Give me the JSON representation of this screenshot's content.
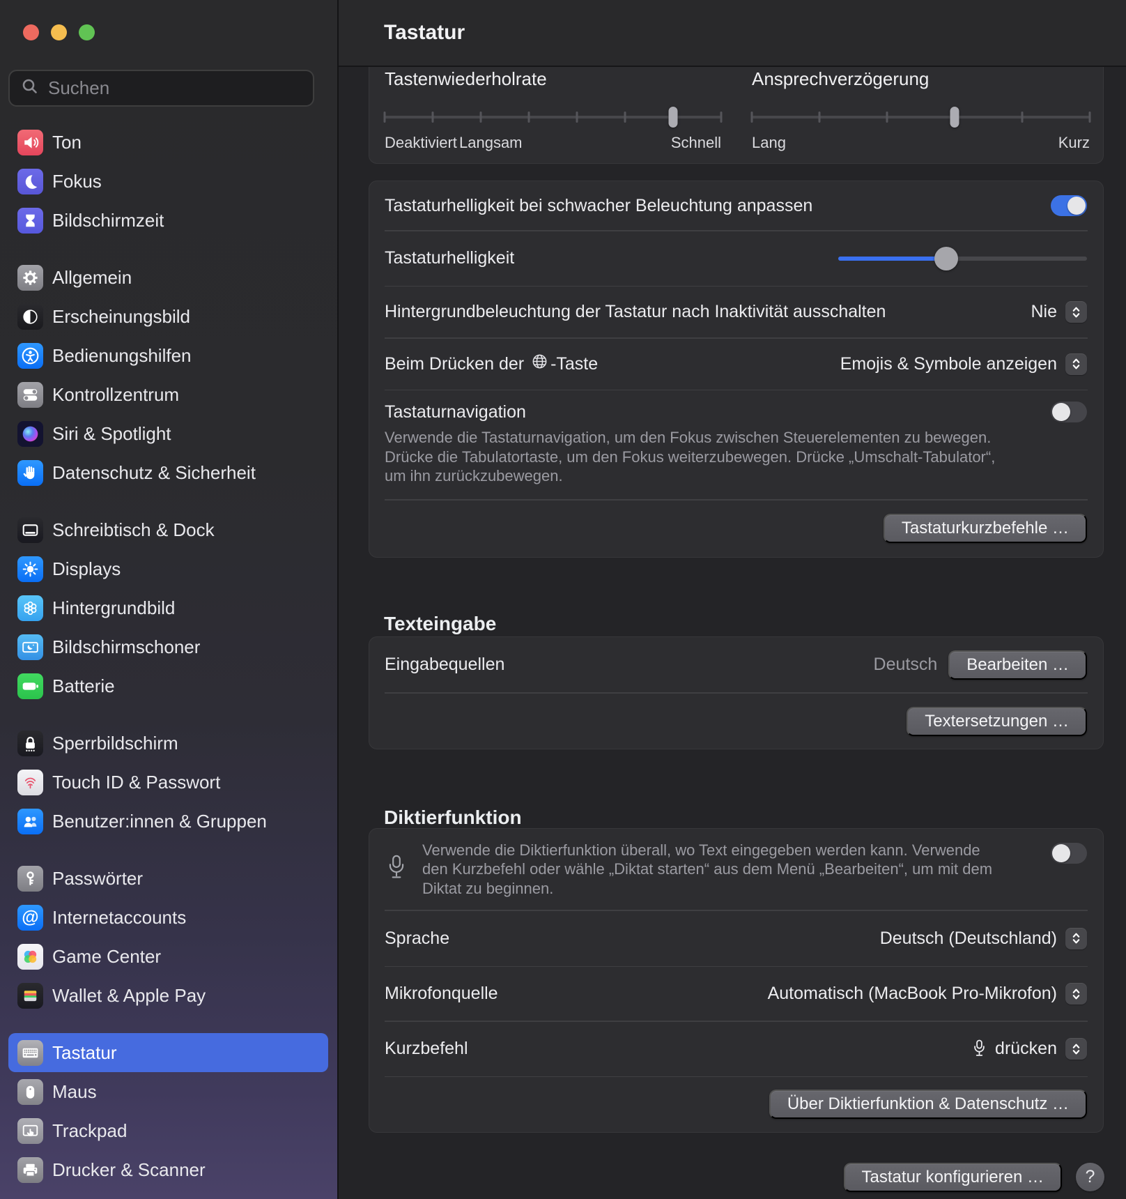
{
  "window": {
    "title": "Tastatur"
  },
  "sidebar": {
    "search_placeholder": "Suchen",
    "items": [
      {
        "label": "Ton",
        "icon": "speaker-icon"
      },
      {
        "label": "Fokus",
        "icon": "moon-icon"
      },
      {
        "label": "Bildschirmzeit",
        "icon": "hourglass-icon"
      },
      {
        "label": "Allgemein",
        "icon": "gear-icon"
      },
      {
        "label": "Erscheinungsbild",
        "icon": "appearance-icon"
      },
      {
        "label": "Bedienungshilfen",
        "icon": "accessibility-icon"
      },
      {
        "label": "Kontrollzentrum",
        "icon": "control-center-icon"
      },
      {
        "label": "Siri & Spotlight",
        "icon": "siri-icon"
      },
      {
        "label": "Datenschutz & Sicherheit",
        "icon": "hand-icon"
      },
      {
        "label": "Schreibtisch & Dock",
        "icon": "desktop-dock-icon"
      },
      {
        "label": "Displays",
        "icon": "display-brightness-icon"
      },
      {
        "label": "Hintergrundbild",
        "icon": "wallpaper-icon"
      },
      {
        "label": "Bildschirmschoner",
        "icon": "screensaver-icon"
      },
      {
        "label": "Batterie",
        "icon": "battery-icon"
      },
      {
        "label": "Sperrbildschirm",
        "icon": "lock-icon"
      },
      {
        "label": "Touch ID & Passwort",
        "icon": "fingerprint-icon"
      },
      {
        "label": "Benutzer:innen & Gruppen",
        "icon": "users-icon"
      },
      {
        "label": "Passwörter",
        "icon": "key-icon"
      },
      {
        "label": "Internetaccounts",
        "icon": "at-icon"
      },
      {
        "label": "Game Center",
        "icon": "game-center-icon"
      },
      {
        "label": "Wallet & Apple Pay",
        "icon": "wallet-icon"
      },
      {
        "label": "Tastatur",
        "icon": "keyboard-icon",
        "selected": true
      },
      {
        "label": "Maus",
        "icon": "mouse-icon"
      },
      {
        "label": "Trackpad",
        "icon": "trackpad-icon"
      },
      {
        "label": "Drucker & Scanner",
        "icon": "printer-icon"
      }
    ]
  },
  "keyboard": {
    "repeat_rate": {
      "label": "Tastenwiederholrate",
      "left_label": "Deaktiviert",
      "mid_label": "Langsam",
      "right_label": "Schnell",
      "knob_left": "85.7%"
    },
    "delay": {
      "label": "Ansprechverzögerung",
      "left_label": "Lang",
      "right_label": "Kurz",
      "knob_left": "60%"
    },
    "adjust_brightness": {
      "label": "Tastaturhelligkeit bei schwacher Beleuchtung anpassen",
      "state": "on"
    },
    "brightness": {
      "label": "Tastaturhelligkeit",
      "fill_width": "43.3%",
      "knob_left": "43.3%"
    },
    "backlight_off": {
      "label": "Hintergrundbeleuchtung der Tastatur nach Inaktivität ausschalten",
      "value": "Nie"
    },
    "globe_key": {
      "label_prefix": "Beim Drücken der",
      "label_suffix": "-Taste",
      "value": "Emojis & Symbole anzeigen"
    },
    "navigation": {
      "label": "Tastaturnavigation",
      "state": "off",
      "description": "Verwende die Tastaturnavigation, um den Fokus zwischen Steuerelementen zu bewegen. Drücke die Tabulatortaste, um den Fokus weiterzubewegen. Drücke „Umschalt-Tabulator“, um ihn zurückzubewegen."
    },
    "shortcuts_button": "Tastaturkurzbefehle …"
  },
  "text_input": {
    "heading": "Texteingabe",
    "input_sources": {
      "label": "Eingabequellen",
      "value": "Deutsch",
      "edit_button": "Bearbeiten …"
    },
    "replacements_button": "Textersetzungen …"
  },
  "dictation": {
    "heading": "Diktierfunktion",
    "description": "Verwende die Diktierfunktion überall, wo Text eingegeben werden kann. Verwende den Kurzbefehl oder wähle „Diktat starten“ aus dem Menü „Bearbeiten“, um mit dem Diktat zu beginnen.",
    "state": "off",
    "language": {
      "label": "Sprache",
      "value": "Deutsch (Deutschland)"
    },
    "microphone": {
      "label": "Mikrofonquelle",
      "value": "Automatisch (MacBook Pro-Mikrofon)"
    },
    "shortcut": {
      "label": "Kurzbefehl",
      "value": "drücken"
    },
    "about_button": "Über Diktierfunktion & Datenschutz …"
  },
  "footer": {
    "configure_button": "Tastatur konfigurieren …",
    "help_label": "?"
  }
}
